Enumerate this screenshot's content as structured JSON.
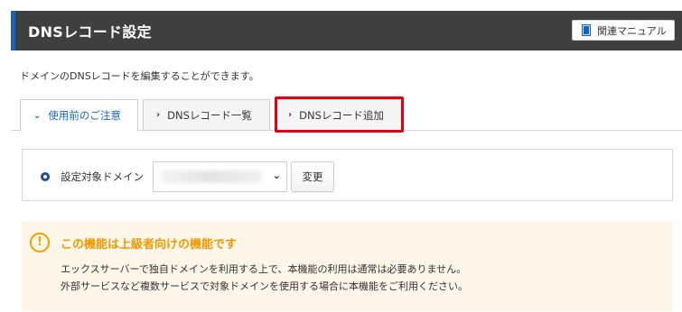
{
  "header": {
    "title": "DNSレコード設定",
    "manual_button": "関連マニュアル"
  },
  "description": "ドメインのDNSレコードを編集することができます。",
  "tabs": [
    {
      "label": "使用前のご注意",
      "active": true
    },
    {
      "label": "DNSレコード一覧",
      "active": false
    },
    {
      "label": "DNSレコード追加",
      "active": false,
      "highlighted": true
    }
  ],
  "domain_select": {
    "label": "設定対象ドメイン",
    "value": "",
    "change_button": "変更"
  },
  "warning": {
    "title": "この機能は上級者向けの機能です",
    "line1": "エックスサーバーで独自ドメインを利用する上で、本機能の利用は通常は必要ありません。",
    "line2": "外部サービスなど複数サービスで対象ドメインを使用する場合に本機能をご利用ください。"
  },
  "colors": {
    "header_bg": "#3f3f3f",
    "accent": "#1565c0",
    "highlight": "#e50012",
    "warning": "#f39800",
    "warning_bg": "#fdf6e9"
  }
}
